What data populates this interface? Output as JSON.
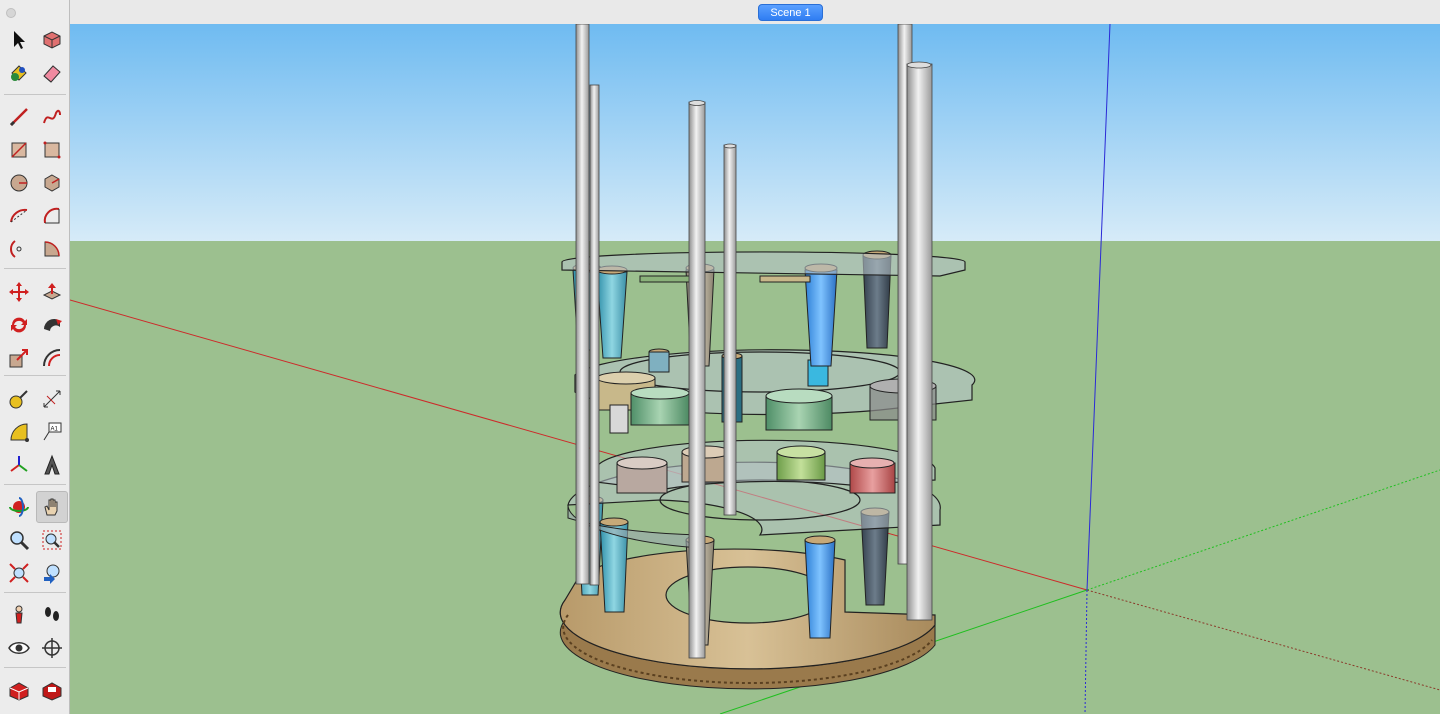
{
  "scene_tab": {
    "label": "Scene 1"
  },
  "colors": {
    "sky_top": "#6bb9f0",
    "sky_bottom": "#d4e9f7",
    "ground": "#9cc08f",
    "axis_red": "#cc2a2a",
    "axis_green": "#1fbf1f",
    "axis_blue": "#2a2ad6",
    "accent": "#2f7df2"
  },
  "toolbar": {
    "tools": [
      {
        "name": "select-icon"
      },
      {
        "name": "make-component-icon"
      },
      {
        "name": "paint-bucket-icon"
      },
      {
        "name": "eraser-icon"
      },
      {
        "name": "line-icon"
      },
      {
        "name": "freehand-icon"
      },
      {
        "name": "rectangle-icon"
      },
      {
        "name": "rotated-rectangle-icon"
      },
      {
        "name": "circle-icon"
      },
      {
        "name": "polygon-icon"
      },
      {
        "name": "arc-icon"
      },
      {
        "name": "two-point-arc-icon"
      },
      {
        "name": "three-point-arc-icon"
      },
      {
        "name": "pie-icon"
      },
      {
        "name": "move-icon"
      },
      {
        "name": "push-pull-icon"
      },
      {
        "name": "rotate-icon"
      },
      {
        "name": "follow-me-icon"
      },
      {
        "name": "scale-icon"
      },
      {
        "name": "offset-icon"
      },
      {
        "name": "tape-measure-icon"
      },
      {
        "name": "dimension-icon"
      },
      {
        "name": "protractor-icon"
      },
      {
        "name": "text-icon"
      },
      {
        "name": "axes-icon"
      },
      {
        "name": "3d-text-icon"
      },
      {
        "name": "orbit-icon"
      },
      {
        "name": "pan-icon"
      },
      {
        "name": "zoom-icon"
      },
      {
        "name": "zoom-window-icon"
      },
      {
        "name": "zoom-extents-icon"
      },
      {
        "name": "previous-view-icon"
      },
      {
        "name": "position-camera-icon"
      },
      {
        "name": "walk-icon"
      },
      {
        "name": "look-around-icon"
      },
      {
        "name": "section-plane-icon"
      },
      {
        "name": "warehouse-icon"
      },
      {
        "name": "extension-warehouse-icon"
      }
    ],
    "active_tool": "pan-icon",
    "text_icon_label": "A1"
  }
}
